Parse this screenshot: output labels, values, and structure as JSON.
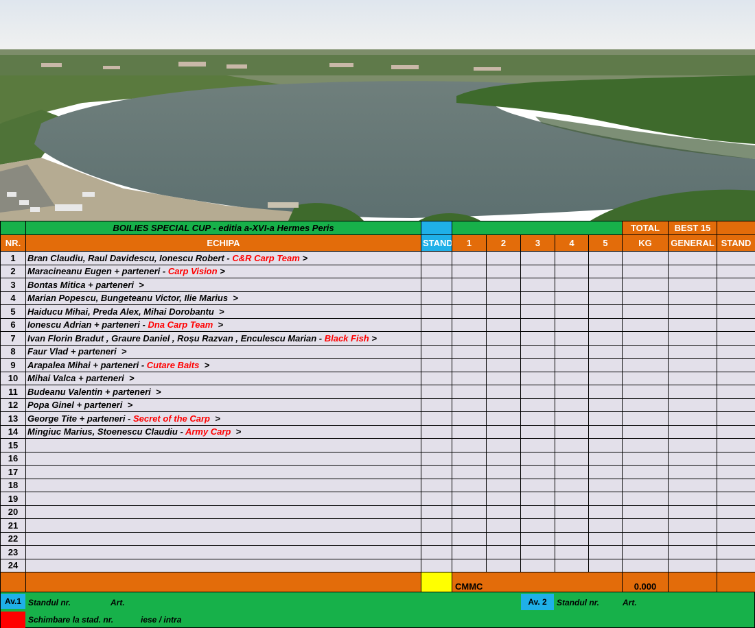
{
  "photo": {
    "description_icon": "aerial-lake-photo"
  },
  "sheet": {
    "title": "BOILIES SPECIAL CUP - editia a-XVI-a Hermes Peris",
    "headers": {
      "nr": "NR.",
      "echipa": "ECHIPA",
      "stand": "STAND",
      "rounds": [
        "1",
        "2",
        "3",
        "4",
        "5"
      ],
      "total_top": "TOTAL",
      "total_bottom": "KG",
      "best_top": "BEST 15",
      "best_bottom": "GENERAL",
      "stand_final": "STAND"
    },
    "rows": [
      {
        "nr": "1",
        "names": "Bran Claudiu, Raul Davidescu, Ionescu Robert - ",
        "brand": "C&R Carp Team",
        "tail": " >"
      },
      {
        "nr": "2",
        "names": "Maracineanu Eugen + parteneri - ",
        "brand": "Carp Vision",
        "tail": " >"
      },
      {
        "nr": "3",
        "names": "Bontas Mitica + parteneri  >",
        "brand": "",
        "tail": ""
      },
      {
        "nr": "4",
        "names": "Marian Popescu, Bungeteanu Victor, Ilie Marius  >",
        "brand": "",
        "tail": ""
      },
      {
        "nr": "5",
        "names": "Haiducu Mihai, Preda Alex, Mihai Dorobantu  >",
        "brand": "",
        "tail": ""
      },
      {
        "nr": "6",
        "names": "Ionescu Adrian + parteneri - ",
        "brand": "Dna Carp Team",
        "tail": "  >"
      },
      {
        "nr": "7",
        "names": "Ivan Florin Bradut , Graure Daniel , Roșu Razvan , Enculescu Marian - ",
        "brand": "Black Fish",
        "tail": " >"
      },
      {
        "nr": "8",
        "names": "Faur Vlad + parteneri  >",
        "brand": "",
        "tail": ""
      },
      {
        "nr": "9",
        "names": "Arapalea Mihai + parteneri - ",
        "brand": "Cutare Baits",
        "tail": "  >"
      },
      {
        "nr": "10",
        "names": "Mihai Valca + parteneri  >",
        "brand": "",
        "tail": ""
      },
      {
        "nr": "11",
        "names": "Budeanu Valentin + parteneri  >",
        "brand": "",
        "tail": ""
      },
      {
        "nr": "12",
        "names": "Popa Ginel + parteneri  >",
        "brand": "",
        "tail": ""
      },
      {
        "nr": "13",
        "names": "George Tite + parteneri - ",
        "brand": "Secret of the Carp",
        "tail": "  >"
      },
      {
        "nr": "14",
        "names": "Mingiuc Marius, Stoenescu Claudiu - ",
        "brand": "Army Carp",
        "tail": "  >"
      },
      {
        "nr": "15",
        "names": "",
        "brand": "",
        "tail": ""
      },
      {
        "nr": "16",
        "names": "",
        "brand": "",
        "tail": ""
      },
      {
        "nr": "17",
        "names": "",
        "brand": "",
        "tail": ""
      },
      {
        "nr": "18",
        "names": "",
        "brand": "",
        "tail": ""
      },
      {
        "nr": "19",
        "names": "",
        "brand": "",
        "tail": ""
      },
      {
        "nr": "20",
        "names": "",
        "brand": "",
        "tail": ""
      },
      {
        "nr": "21",
        "names": "",
        "brand": "",
        "tail": ""
      },
      {
        "nr": "22",
        "names": "",
        "brand": "",
        "tail": ""
      },
      {
        "nr": "23",
        "names": "",
        "brand": "",
        "tail": ""
      },
      {
        "nr": "24",
        "names": "",
        "brand": "",
        "tail": ""
      }
    ],
    "totals": {
      "cmmc": "CMMC",
      "total_kg": "0.000"
    },
    "footer": {
      "av1": "Av.1",
      "standul_nr": "Standul nr.",
      "art": "Art.",
      "av2": "Av. 2",
      "standul_nr2": "Standul  nr.",
      "art2": "Art.",
      "schimbare": "Schimbare la stad.  nr.",
      "iese": "iese / intra"
    }
  },
  "colors": {
    "green": "#17b14a",
    "orange": "#e36c0a",
    "blue": "#1fb0e8",
    "lavender": "#e3e0ea",
    "brand_red": "#ff0000",
    "yellow": "#ffff00"
  }
}
